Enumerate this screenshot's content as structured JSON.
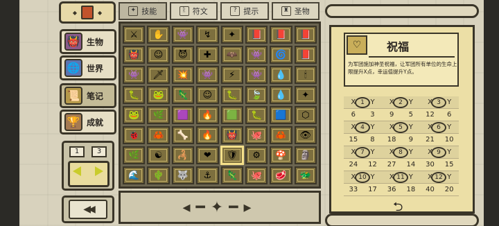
{
  "sidebar": {
    "categories": [
      {
        "label": "生物",
        "icon": "creature-icon",
        "glyph": "👹"
      },
      {
        "label": "世界",
        "icon": "world-icon",
        "glyph": "🌐"
      },
      {
        "label": "笔记",
        "icon": "notes-icon",
        "glyph": "📜"
      },
      {
        "label": "成就",
        "icon": "achievement-icon",
        "glyph": "🏆"
      }
    ],
    "page_current": "1",
    "page_total": "3"
  },
  "tabs": [
    {
      "label": "技能",
      "icon": "skill-icon"
    },
    {
      "label": "符文",
      "icon": "rune-icon"
    },
    {
      "label": "提示",
      "icon": "hint-icon"
    },
    {
      "label": "圣物",
      "icon": "relic-icon"
    }
  ],
  "grid_glyphs": [
    "⚔",
    "✋",
    "👾",
    "↯",
    "✦",
    "📕",
    "📕",
    "📕",
    "👹",
    "☺",
    "😈",
    "✚",
    "🦇",
    "👾",
    "🌀",
    "📕",
    "👾",
    "🗡",
    "💥",
    "👾",
    "⚡",
    "👾",
    "💧",
    "🕯",
    "🐛",
    "🐸",
    "🦎",
    "☺",
    "🐛",
    "🍃",
    "💧",
    "✦",
    "🐸",
    "🌿",
    "🟪",
    "🔥",
    "🟩",
    "🐛",
    "🟦",
    "⬡",
    "🐞",
    "🦀",
    "🦴",
    "🔥",
    "👹",
    "🐙",
    "🦀",
    "👁",
    "🌿",
    "☯",
    "🦂",
    "❤",
    "🛡",
    "⚙",
    "🍄",
    "🗿",
    "🌊",
    "🌵",
    "🐺",
    "⚓",
    "🦎",
    "🐙",
    "🥩",
    "🐲"
  ],
  "detail": {
    "title": "祝福",
    "description": "为军团施加神圣祝福，让军团所有单位的生命上限提升X点，幸运值提升Y点。",
    "levels": [
      "1",
      "2",
      "3",
      "4",
      "5",
      "6",
      "7",
      "8",
      "9",
      "10",
      "11",
      "12"
    ],
    "xy_labels": [
      "X",
      "Y"
    ],
    "values": [
      [
        6,
        3,
        9,
        5,
        12,
        6
      ],
      [
        15,
        8,
        18,
        9,
        21,
        10
      ],
      [
        24,
        12,
        27,
        14,
        30,
        15
      ],
      [
        33,
        17,
        36,
        18,
        40,
        20
      ]
    ],
    "return_symbol": "⮌"
  }
}
